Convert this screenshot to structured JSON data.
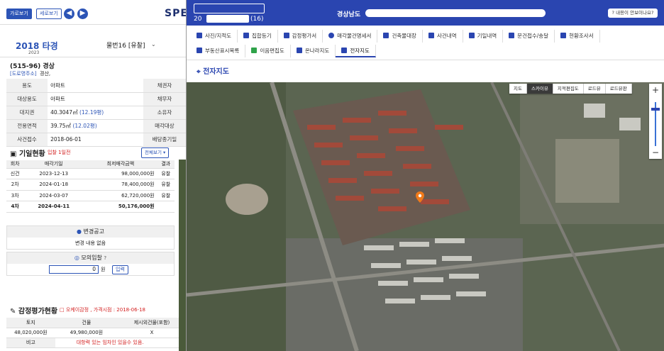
{
  "left": {
    "toolbar": {
      "landscape": "가로보기",
      "portrait": "세로보기",
      "back_icon": "arrow-left",
      "fwd_icon": "arrow-right"
    },
    "logo": "SPEI",
    "case_year": "2018 타경",
    "property_no": "물번16 [유찰]",
    "case_number": "(515-96) 경상",
    "address_tag": "[도로명주소]",
    "address_text": "경산,",
    "info_rows": [
      {
        "l": "용도",
        "v": "아파트",
        "l2": "채권자"
      },
      {
        "l": "대상용도",
        "v": "아파트",
        "l2": "채무자"
      },
      {
        "l": "대지권",
        "v": "40.3047㎡",
        "v2": "(12.19평)",
        "l2": "소유자"
      },
      {
        "l": "전용면적",
        "v": "39.75㎡",
        "v2": "(12.02평)",
        "l2": "매각대상"
      },
      {
        "l": "사건접수",
        "v": "2018-06-01",
        "l2": "배당종기일"
      }
    ],
    "history_title": "기일현황",
    "history_note": "입찰 1일전",
    "history_btn": "전체보기",
    "history_head": [
      "회차",
      "매각기일",
      "최저매각금액",
      "결과"
    ],
    "history_rows": [
      {
        "r": "신건",
        "d": "2023-12-13",
        "p": "98,000,000원",
        "s": "유찰"
      },
      {
        "r": "2차",
        "d": "2024-01-18",
        "p": "78,400,000원",
        "s": "유찰"
      },
      {
        "r": "3차",
        "d": "2024-03-07",
        "p": "62,720,000원",
        "s": "유찰"
      },
      {
        "r": "4차",
        "d": "2024-04-11",
        "p": "50,176,000원",
        "s": ""
      }
    ],
    "change_title": "변경공고",
    "change_text": "변경 내용 없음",
    "mock_title": "모의입찰",
    "mock_value": "0",
    "mock_unit": "원",
    "mock_btn": "입력",
    "appraisal_title": "감정평가현황",
    "appraisal_note": "오케이감정 , 가격시점 : 2018-06-18",
    "appraisal_head": [
      "토지",
      "건물",
      "제시외건물(포함)"
    ],
    "appraisal_vals": [
      "48,020,000원",
      "49,980,000원",
      "X"
    ],
    "remark_label": "비고",
    "remark_text": "대항력 있는 임차인 있을수 있음."
  },
  "popup": {
    "header_left": "20",
    "header_suffix": "(16)",
    "region": "경상남도",
    "help": "내용이 안보이나요?",
    "tabs_row1": [
      "사진/지적도",
      "집합등기",
      "감정평가서",
      "매각물건명세서",
      "건축물대장",
      "사건내역",
      "기일내역",
      "문건접수/송달",
      "현황조사서"
    ],
    "tabs_row2": [
      "부동산표시목록",
      "이음편집도",
      "온나라지도",
      "전자지도"
    ],
    "page_title": "전자지도",
    "map_buttons": [
      "지도",
      "스카이뷰",
      "지적편집도",
      "로드뷰",
      "로드뷰판"
    ],
    "map_active": "스카이뷰",
    "zoom_in": "+",
    "zoom_out": "−",
    "marker_icon": "location-pin-icon"
  }
}
